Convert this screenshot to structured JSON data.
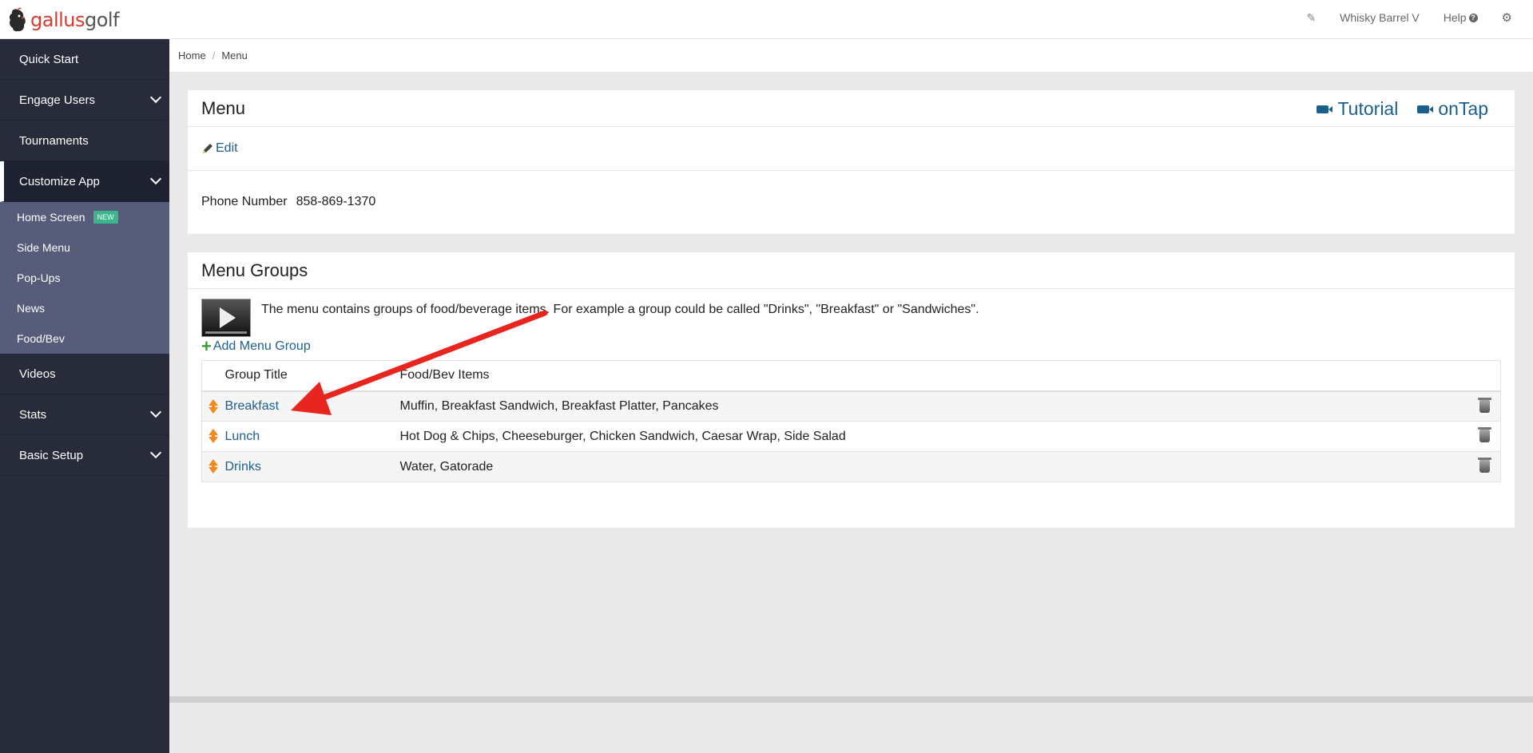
{
  "brand": {
    "part1": "gallus",
    "part2": "golf"
  },
  "topbar": {
    "user": "Whisky Barrel V",
    "help": "Help"
  },
  "sidebar": {
    "items": [
      {
        "label": "Quick Start",
        "name": "quick-start"
      },
      {
        "label": "Engage Users",
        "name": "engage-users"
      },
      {
        "label": "Tournaments",
        "name": "tournaments"
      },
      {
        "label": "Customize App",
        "name": "customize-app"
      },
      {
        "label": "Videos",
        "name": "videos"
      },
      {
        "label": "Stats",
        "name": "stats"
      },
      {
        "label": "Basic Setup",
        "name": "basic-setup"
      }
    ],
    "submenu": [
      {
        "label": "Home Screen",
        "badge": "NEW"
      },
      {
        "label": "Side Menu"
      },
      {
        "label": "Pop-Ups"
      },
      {
        "label": "News"
      },
      {
        "label": "Food/Bev"
      }
    ]
  },
  "breadcrumb": {
    "home": "Home",
    "sep": "/",
    "current": "Menu"
  },
  "menu_panel": {
    "title": "Menu",
    "tutorial": "Tutorial",
    "ontap": "onTap",
    "edit": "Edit",
    "phone_label": "Phone Number",
    "phone_value": "858-869-1370"
  },
  "groups_panel": {
    "title": "Menu Groups",
    "description": "The menu contains groups of food/beverage items. For example a group could be called \"Drinks\", \"Breakfast\" or \"Sandwiches\".",
    "add_label": "Add Menu Group",
    "columns": {
      "title": "Group Title",
      "items": "Food/Bev Items"
    },
    "rows": [
      {
        "title": "Breakfast",
        "items": "Muffin, Breakfast Sandwich, Breakfast Platter, Pancakes"
      },
      {
        "title": "Lunch",
        "items": "Hot Dog & Chips, Cheeseburger, Chicken Sandwich, Caesar Wrap, Side Salad"
      },
      {
        "title": "Drinks",
        "items": "Water, Gatorade"
      }
    ]
  },
  "colors": {
    "accent_arrow": "#e8251e",
    "link": "#1b5f8c",
    "sidebar": "#272b3a",
    "submenu": "#565c7a",
    "badge": "#3cb58c"
  }
}
